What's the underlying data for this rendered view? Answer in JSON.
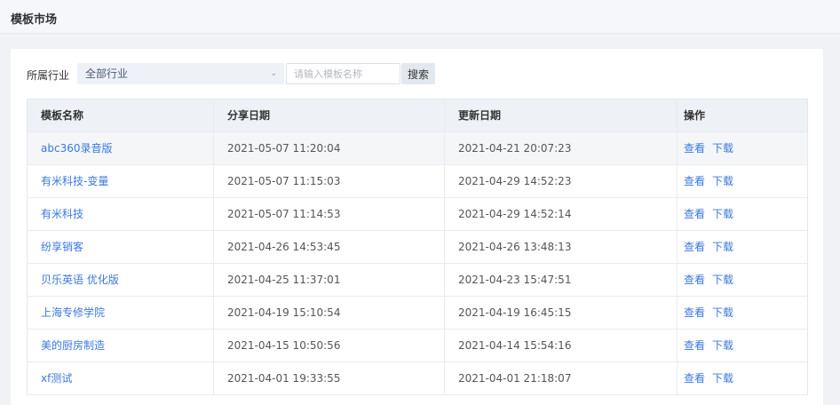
{
  "header": {
    "title": "模板市场"
  },
  "filter": {
    "industry_label": "所属行业",
    "industry_value": "全部行业",
    "search_placeholder": "请输入模板名称",
    "search_button": "搜索"
  },
  "table": {
    "columns": [
      "模板名称",
      "分享日期",
      "更新日期",
      "操作"
    ],
    "actions": {
      "view": "查看",
      "download": "下载"
    },
    "rows": [
      {
        "name": "abc360录音版",
        "shared": "2021-05-07 11:20:04",
        "updated": "2021-04-21 20:07:23"
      },
      {
        "name": "有米科技-变量",
        "shared": "2021-05-07 11:15:03",
        "updated": "2021-04-29 14:52:23"
      },
      {
        "name": "有米科技",
        "shared": "2021-05-07 11:14:53",
        "updated": "2021-04-29 14:52:14"
      },
      {
        "name": "纷享销客",
        "shared": "2021-04-26 14:53:45",
        "updated": "2021-04-26 13:48:13"
      },
      {
        "name": "贝乐英语 优化版",
        "shared": "2021-04-25 11:37:01",
        "updated": "2021-04-23 15:47:51"
      },
      {
        "name": "上海专修学院",
        "shared": "2021-04-19 15:10:54",
        "updated": "2021-04-19 16:45:15"
      },
      {
        "name": "美的厨房制造",
        "shared": "2021-04-15 10:50:56",
        "updated": "2021-04-14 15:54:16"
      },
      {
        "name": "xf测试",
        "shared": "2021-04-01 19:33:55",
        "updated": "2021-04-01 21:18:07"
      }
    ]
  }
}
